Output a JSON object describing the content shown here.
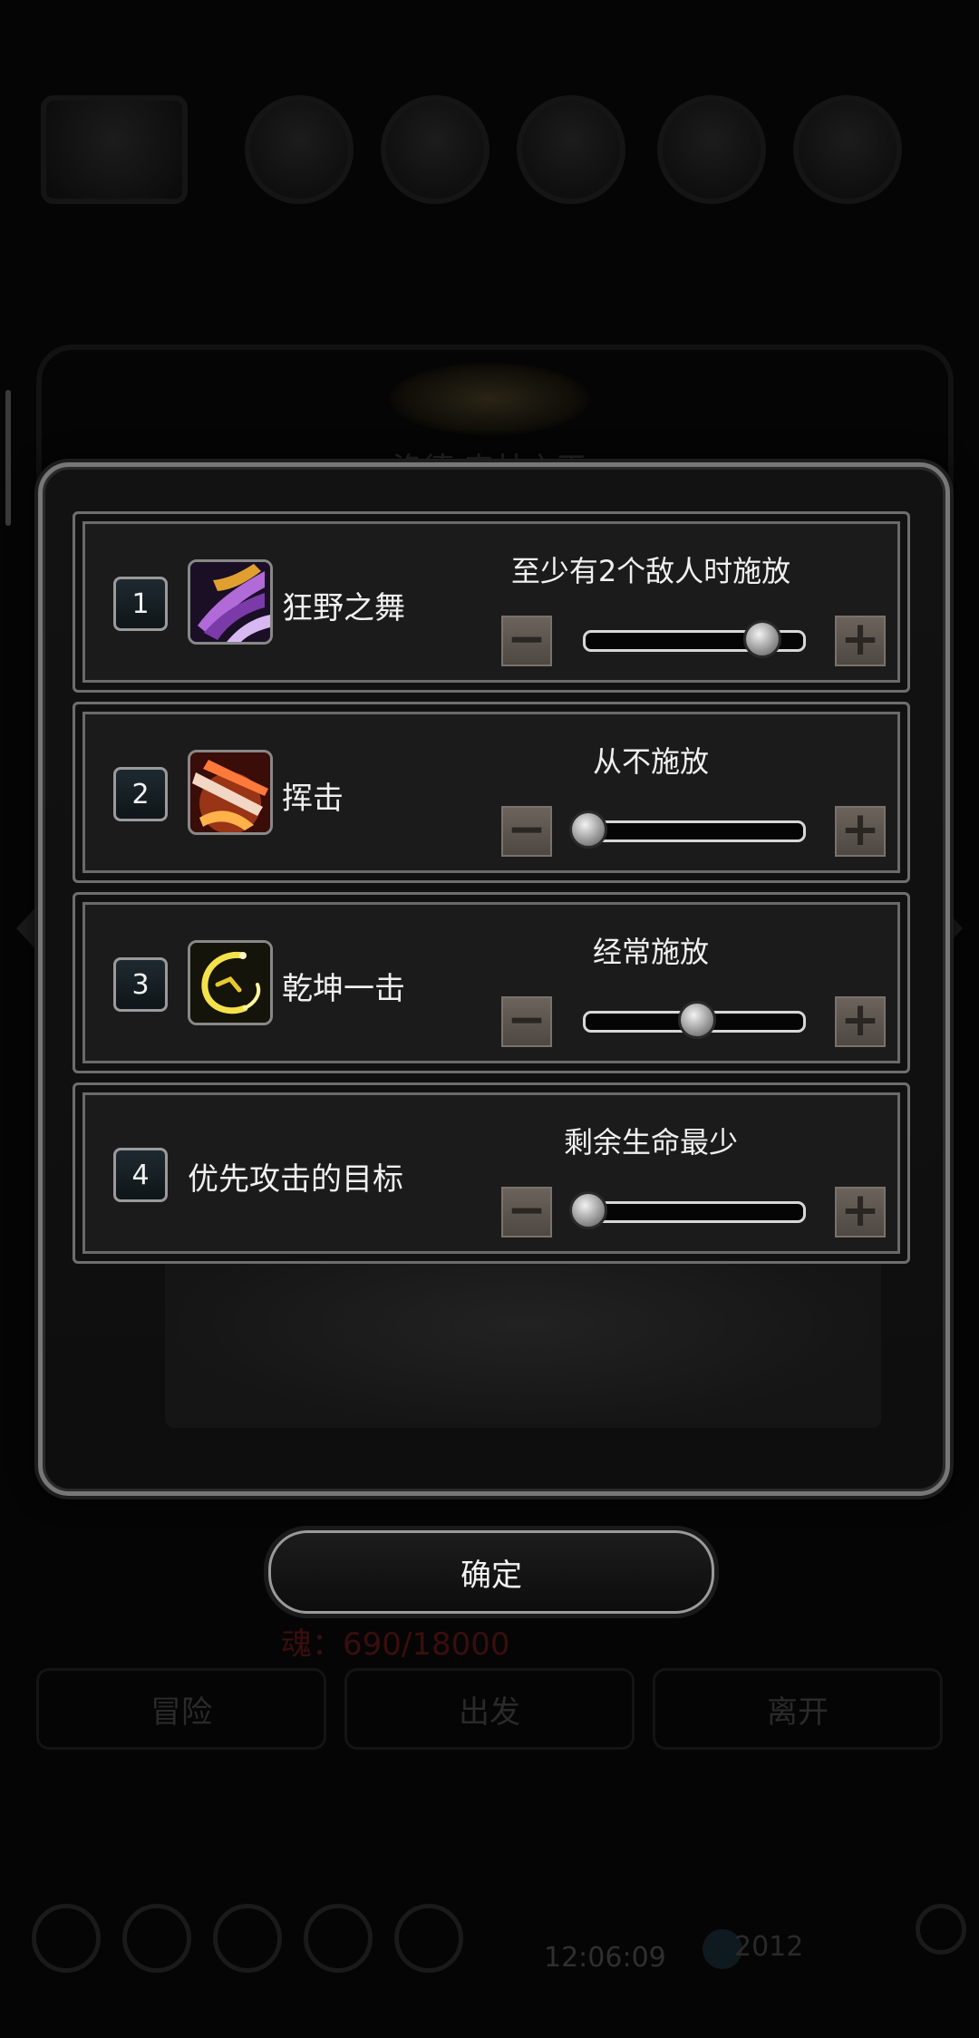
{
  "background": {
    "title": "洛德·森林之王",
    "soul_text": "魂：690/18000",
    "tabs": [
      "冒险",
      "出发",
      "离开"
    ],
    "time": "12:06:09",
    "gem_count": "2012"
  },
  "skills": [
    {
      "index": "1",
      "name": "狂野之舞",
      "icon": "purple-slash-icon",
      "mode": "至少有2个敌人时施放",
      "level": 0.8
    },
    {
      "index": "2",
      "name": "挥击",
      "icon": "red-strike-icon",
      "mode": "从不施放",
      "level": 0.0
    },
    {
      "index": "3",
      "name": "乾坤一击",
      "icon": "yellow-swirl-icon",
      "mode": "经常施放",
      "level": 0.5
    },
    {
      "index": "4",
      "name": "优先攻击的目标",
      "mode": "剩余生命最少",
      "level": 0.0
    }
  ],
  "controls": {
    "minus": "−",
    "plus": "+"
  },
  "confirm_label": "确定",
  "colors": {
    "panel": "#1b1b1b",
    "border": "#6e6e6e",
    "button": "#5d5650"
  }
}
